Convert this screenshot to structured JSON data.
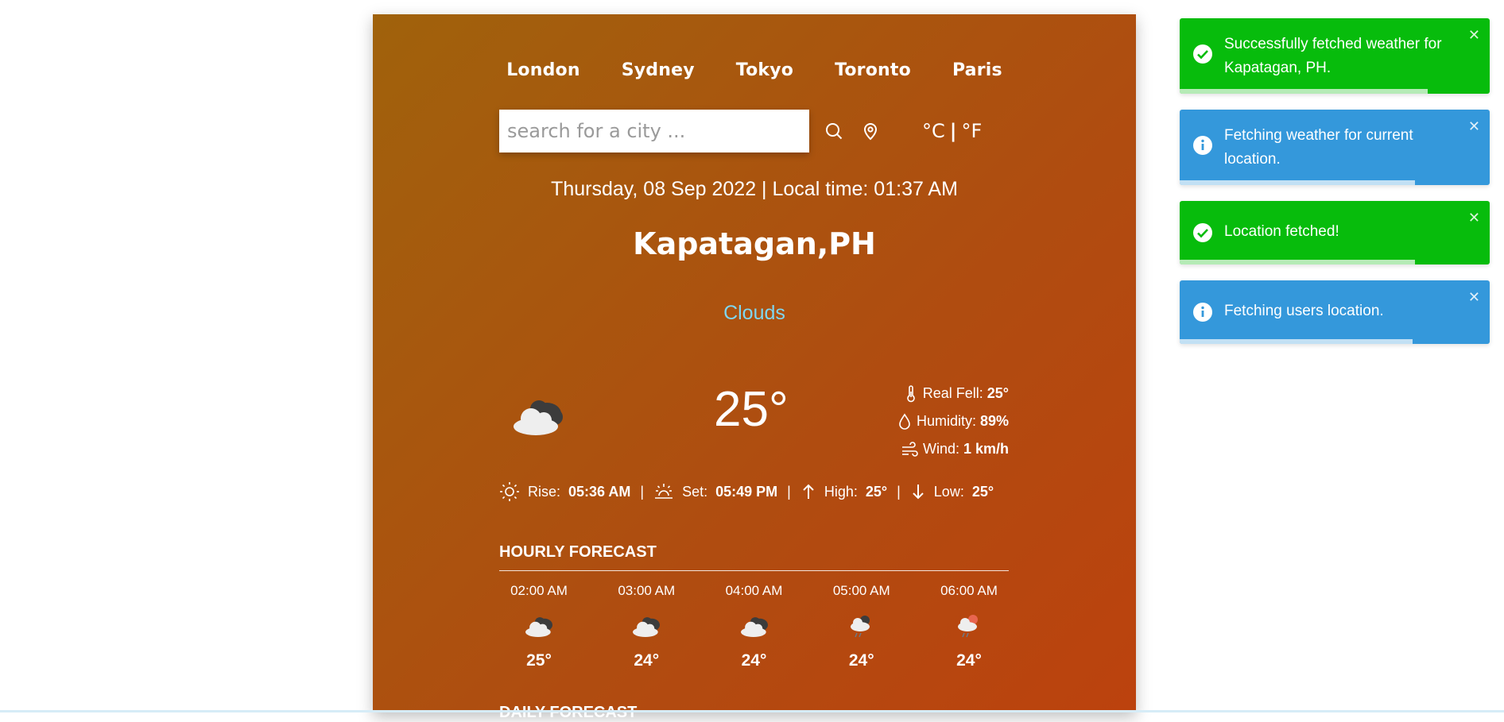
{
  "cities": [
    "London",
    "Sydney",
    "Tokyo",
    "Toronto",
    "Paris"
  ],
  "search": {
    "placeholder": "search for a city ...",
    "value": ""
  },
  "icons": {
    "search": "search-icon",
    "location": "location-pin-icon"
  },
  "units": {
    "celsius": "°C",
    "separator": "|",
    "fahrenheit": "°F"
  },
  "datetime": "Thursday, 08 Sep 2022 | Local time: 01:37 AM",
  "location": "Kapatagan,PH",
  "condition": "Clouds",
  "current": {
    "temp": "25°",
    "icon": "broken-clouds-icon",
    "real_feel_label": "Real Fell:",
    "real_feel_value": "25°",
    "humidity_label": "Humidity:",
    "humidity_value": "89%",
    "wind_label": "Wind:",
    "wind_value": "1 km/h"
  },
  "sun": {
    "rise_label": "Rise:",
    "rise_value": "05:36 AM",
    "set_label": "Set:",
    "set_value": "05:49 PM",
    "high_label": "High:",
    "high_value": "25°",
    "low_label": "Low:",
    "low_value": "25°",
    "sep": "|"
  },
  "hourly_title": "HOURLY FORECAST",
  "hourly": [
    {
      "time": "02:00 AM",
      "temp": "25°",
      "icon": "broken-clouds-icon"
    },
    {
      "time": "03:00 AM",
      "temp": "24°",
      "icon": "broken-clouds-icon"
    },
    {
      "time": "04:00 AM",
      "temp": "24°",
      "icon": "broken-clouds-icon"
    },
    {
      "time": "05:00 AM",
      "temp": "24°",
      "icon": "rain-night-icon"
    },
    {
      "time": "06:00 AM",
      "temp": "24°",
      "icon": "rain-day-icon"
    }
  ],
  "daily_title": "DAILY FORECAST",
  "toasts": [
    {
      "type": "success",
      "icon": "check-circle-icon",
      "message": "Successfully fetched weather for Kapatagan, PH.",
      "close": "✕",
      "progress": 0.8
    },
    {
      "type": "info",
      "icon": "info-circle-icon",
      "message": "Fetching weather for current location.",
      "close": "✕",
      "progress": 0.76
    },
    {
      "type": "success",
      "icon": "check-circle-icon",
      "message": "Location fetched!",
      "close": "✕",
      "progress": 0.76
    },
    {
      "type": "info",
      "icon": "info-circle-icon",
      "message": "Fetching users location.",
      "close": "✕",
      "progress": 0.75
    }
  ],
  "colors": {
    "success": "#07bc0c",
    "info": "#3498db",
    "condition": "#7fd6f0"
  }
}
